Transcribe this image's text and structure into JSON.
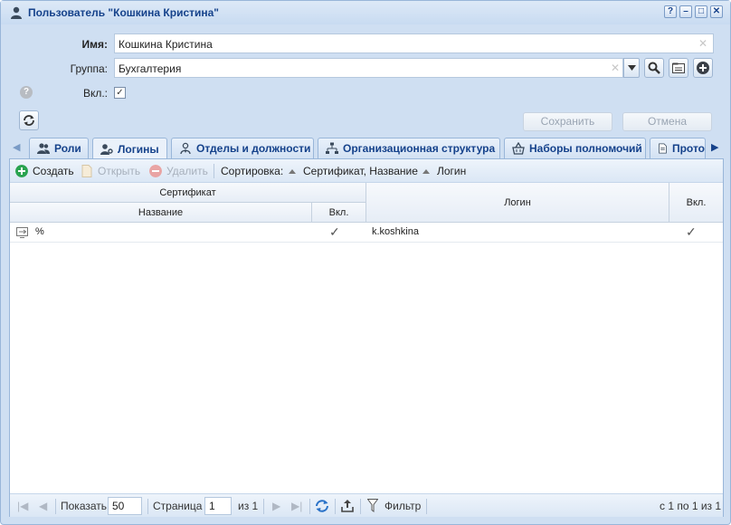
{
  "window": {
    "title": "Пользователь \"Кошкина Кристина\"",
    "controls": [
      "?",
      "–",
      "□",
      "✕"
    ]
  },
  "form": {
    "name_label": "Имя:",
    "name_value": "Кошкина Кристина",
    "group_label": "Группа:",
    "group_value": "Бухгалтерия",
    "enabled_label": "Вкл.:",
    "enabled_checked": true
  },
  "buttons": {
    "save": "Сохранить",
    "cancel": "Отмена"
  },
  "tabs": [
    {
      "label": "Роли",
      "icon": "users-icon"
    },
    {
      "label": "Логины",
      "icon": "user-key-icon",
      "active": true
    },
    {
      "label": "Отделы и должности",
      "icon": "department-icon"
    },
    {
      "label": "Организационная структура",
      "icon": "org-structure-icon"
    },
    {
      "label": "Наборы полномочий",
      "icon": "basket-icon"
    },
    {
      "label": "Прото",
      "icon": "document-icon"
    }
  ],
  "toolbar": {
    "create": "Создать",
    "open": "Открыть",
    "delete": "Удалить",
    "sort_label": "Сортировка:",
    "sort_cert": "Сертификат, Название",
    "sort_login": "Логин"
  },
  "grid": {
    "headers": {
      "certificate": "Сертификат",
      "name": "Название",
      "cert_enabled": "Вкл.",
      "login": "Логин",
      "login_enabled": "Вкл."
    },
    "rows": [
      {
        "name": "%",
        "cert_enabled": "✓",
        "login": "k.koshkina",
        "login_enabled": "✓"
      }
    ]
  },
  "pager": {
    "show_label": "Показать",
    "page_size": "50",
    "page_label": "Страница",
    "page_value": "1",
    "of_label": "из 1",
    "filter_label": "Фильтр",
    "summary": "с 1 по 1 из 1"
  },
  "colors": {
    "accent": "#15428b",
    "window_bg": "#cfdff2",
    "create_green": "#2aa350",
    "delete_red": "#e07070"
  }
}
